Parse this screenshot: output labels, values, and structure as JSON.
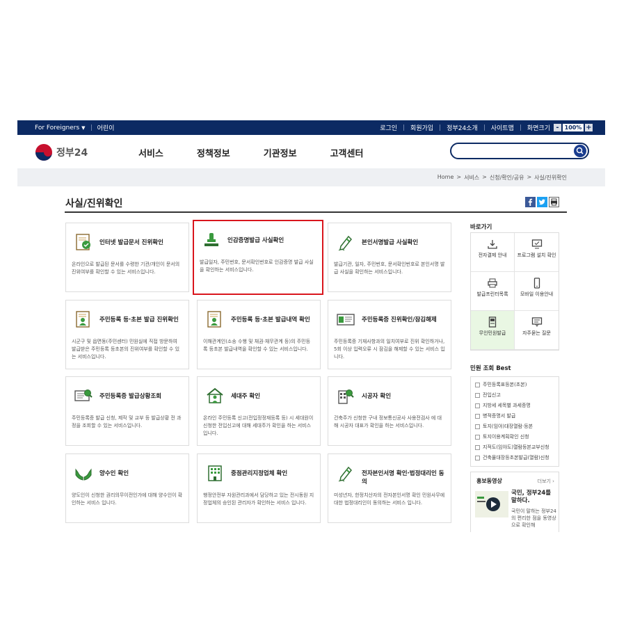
{
  "topbar": {
    "foreigners": "For Foreigners",
    "kids": "어린이",
    "links": [
      "로그인",
      "회원가입",
      "정부24소개",
      "사이트맵"
    ],
    "zoom_label": "화면크기",
    "zoom_minus": "-",
    "zoom_value": "100%",
    "zoom_plus": "+"
  },
  "header": {
    "logo_text": "정부24",
    "menu": [
      "서비스",
      "정책정보",
      "기관정보",
      "고객센터"
    ],
    "search_placeholder": ""
  },
  "breadcrumb": [
    "Home",
    ">",
    "서비스",
    ">",
    "신청/확인/공유",
    ">",
    "사실/진위확인"
  ],
  "page_title": "사실/진위확인",
  "cards": [
    {
      "title": "인터넷 발급문서 진위확인",
      "desc": "온라인으로 발급된 문서를 수령한 기관/개인이 문서의 진위여부를 확인할 수 있는 서비스입니다.",
      "icon": "document-check-icon"
    },
    {
      "title": "인감증명발급 사실확인",
      "desc": "발급일자, 주민번호, 문서확인번호로 인감증명 발급 사실을 확인하는 서비스입니다.",
      "icon": "seal-stamp-icon"
    },
    {
      "title": "본인서명발급 사실확인",
      "desc": "발급기관, 일자, 주민번호, 문서확인번호로 본인서명 발급 사실을 확인하는 서비스입니다.",
      "icon": "pen-sign-icon"
    },
    {
      "title": "주민등록 등·초본 발급 진위확인",
      "desc": "시군구 및 읍면동(주민센터) 민원실에 직접 방문하여 발급받은 주민등록 등초본의 진위여부를 확인할 수 있는 서비스입니다.",
      "icon": "resident-doc-icon"
    },
    {
      "title": "주민등록 등·초본 발급내역 확인",
      "desc": "이해관계인(소송 수행 및 채권·채무관계 등)의 주민등록 등초본 발급내역을 확인할 수 있는 서비스입니다.",
      "icon": "resident-doc-icon"
    },
    {
      "title": "주민등록증 진위확인/잠김해제",
      "desc": "주민등록증 기재사항과의 일치여부로 진위 확인하거나, 5회 이상 입력오류 시 잠김을 해제할 수 있는 서비스 입니다.",
      "icon": "id-card-icon"
    },
    {
      "title": "주민등록증 발급상황조회",
      "desc": "주민등록증 발급 신청, 제작 및 교부 등 발급상황 전 과정을 조회할 수 있는 서비스입니다.",
      "icon": "id-card-search-icon"
    },
    {
      "title": "세대주 확인",
      "desc": "온라인 주민등록 신고(전입정정재등록 등) 시 세대원이 신청한 전입신고에 대해 세대주가 확인을 하는 서비스입니다.",
      "icon": "house-person-icon"
    },
    {
      "title": "시공자 확인",
      "desc": "건축주가 신청한 구내 정보통신공사 사용전검사 에 대해 시공자 대표가 확인을 하는 서비스입니다.",
      "icon": "building-search-icon"
    },
    {
      "title": "양수인 확인",
      "desc": "양도인이 신청한 권리의무이전인가에 대해 양수인이 확인하는 서비스 입니다.",
      "icon": "hands-icon"
    },
    {
      "title": "중점관리지정업체 확인",
      "desc": "행정안전부 자원관리과에서 담당하고 있는 전시동원 지정업체의 승인된 관리자가 확인하는 서비스 입니다.",
      "icon": "building-icon"
    },
    {
      "title": "전자본인서명 확인·법정대리인 동의",
      "desc": "미성년자, 한정치산자의 전자본인서명 확인 민원사무에 대한 법정대리인이 동의하는 서비스 입니다.",
      "icon": "pen-sign-icon"
    }
  ],
  "sidebar": {
    "quick_title": "바로가기",
    "quick": [
      {
        "label": "전자결제 안내",
        "icon": "download-icon"
      },
      {
        "label": "프로그램 설치 확인",
        "icon": "monitor-check-icon"
      },
      {
        "label": "발급프린터목록",
        "icon": "printer-icon"
      },
      {
        "label": "모바일 이용안내",
        "icon": "mobile-icon"
      },
      {
        "label": "무인민원발급",
        "icon": "kiosk-icon"
      },
      {
        "label": "자주묻는 질문",
        "icon": "chat-icon"
      }
    ],
    "best_title": "민원 조회 Best",
    "best": [
      "주민등록표등본(초본)",
      "전입신고",
      "지방세 세목별 과세증명",
      "병적증명서 발급",
      "토지(임야)대장열람·등본",
      "토지이용계획확인 신청",
      "지적도(임야도)열람등본교부신청",
      "건축물대장등초본발급(열람)신청"
    ],
    "promo_title": "홍보동영상",
    "promo_more": "더보기 ›",
    "promo_headline": "국민, 정부24를 말하다.",
    "promo_desc": "국민이 말하는 정부24의 편리한 점을 동영상으로 확인해"
  },
  "colors": {
    "navy": "#0c2a63",
    "green": "#2f7d32",
    "red": "#d9151c"
  }
}
